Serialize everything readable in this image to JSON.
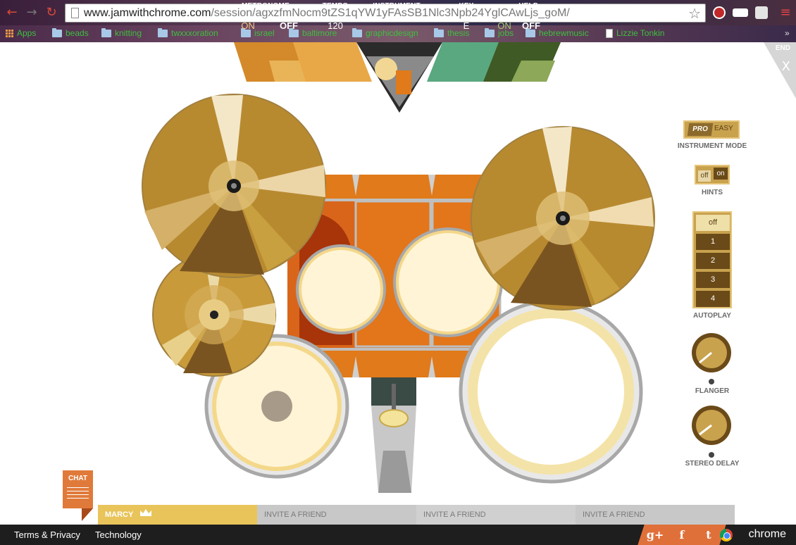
{
  "browser": {
    "url_domain": "www.jamwithchrome.com",
    "url_path": "/session/agxzfmNocm9tZS1qYW1yFAsSB1Nlc3Npb24YglCAwLjs_goM/",
    "bookmarks": [
      "Apps",
      "beads",
      "knitting",
      "twxxxoration",
      "israel",
      "baltimore",
      "graphicdesign",
      "thesis",
      "jobs",
      "hebrewmusic",
      "Lizzie Tonkin"
    ]
  },
  "top_nav": {
    "metronome": {
      "label": "METRONOME",
      "on": "ON",
      "off": "OFF"
    },
    "tempo": {
      "label": "TEMPO",
      "value": "120"
    },
    "instrument": {
      "label": "INSTRUMENT"
    },
    "key": {
      "label": "KEY",
      "value": "E"
    },
    "help": {
      "label": "HELP",
      "on": "ON",
      "off": "OFF"
    },
    "end": {
      "label": "END",
      "close": "X"
    }
  },
  "right_panel": {
    "mode": {
      "pro": "PRO",
      "easy": "EASY",
      "label": "INSTRUMENT MODE"
    },
    "hints": {
      "off": "off",
      "on": "on",
      "label": "HINTS"
    },
    "autoplay": {
      "items": [
        "off",
        "1",
        "2",
        "3",
        "4"
      ],
      "selected": "off",
      "label": "AUTOPLAY"
    },
    "flanger": {
      "label": "FLANGER"
    },
    "stereo_delay": {
      "label": "STEREO DELAY"
    }
  },
  "chat": {
    "label": "CHAT"
  },
  "players": [
    {
      "name": "MARCY"
    },
    {
      "name": "INVITE A FRIEND"
    },
    {
      "name": "INVITE A FRIEND"
    },
    {
      "name": "INVITE A FRIEND"
    }
  ],
  "footer": {
    "terms": "Terms & Privacy",
    "technology": "Technology",
    "social": [
      "g+",
      "f",
      "t"
    ],
    "brand": "chrome"
  },
  "colors": {
    "metronome": "#d48a2a",
    "tempo": "#e9a848",
    "key": "#5aa880",
    "help": "#6a8a3a",
    "accent": "#e8c45a"
  }
}
